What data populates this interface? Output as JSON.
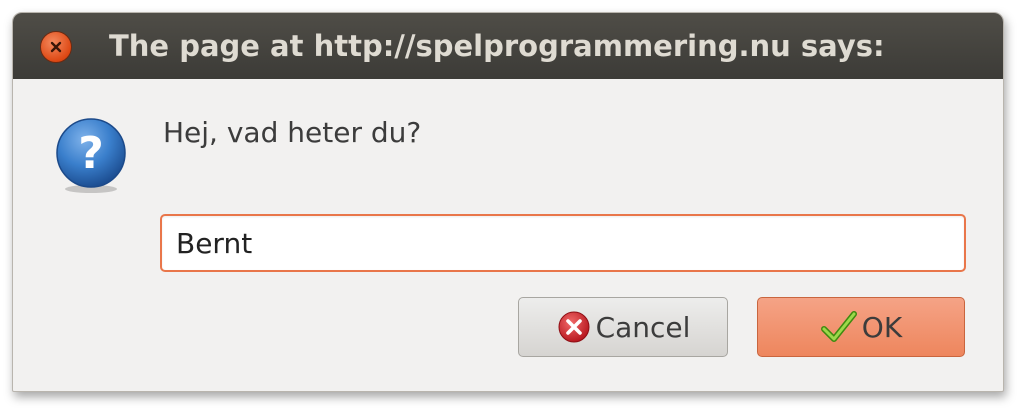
{
  "dialog": {
    "title": "The page at http://spelprogrammering.nu says:",
    "prompt": "Hej, vad heter du?",
    "input_value": "Bernt",
    "buttons": {
      "cancel_label": "Cancel",
      "ok_label": "OK"
    },
    "icons": {
      "close": "close-icon",
      "question": "question-icon",
      "cancel": "cancel-icon",
      "ok": "checkmark-icon"
    },
    "colors": {
      "titlebar": "#3c3b37",
      "accent": "#e9764a",
      "close_button": "#dd4814",
      "ok_button": "#ee865d",
      "question_icon": "#2f74c0"
    }
  }
}
